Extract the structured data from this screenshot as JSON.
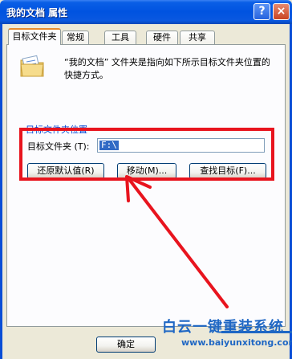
{
  "window": {
    "title": "我的文档 属性",
    "help_glyph": "?",
    "close_glyph": "×"
  },
  "tabs": [
    {
      "label": "目标文件夹",
      "active": true
    },
    {
      "label": "常规",
      "active": false
    },
    {
      "label": "工具",
      "active": false
    },
    {
      "label": "硬件",
      "active": false
    },
    {
      "label": "共享",
      "active": false
    }
  ],
  "content": {
    "description": "“我的文档” 文件夹是指向如下所示目标文件夹位置的快捷方式。",
    "group_title": "目标文件夹位置",
    "field_label": "目标文件夹 (T):",
    "field_value": "F:\\"
  },
  "buttons": {
    "restore_default": "还原默认值(R)",
    "move": "移动(M)...",
    "find_target": "查找目标(F)...",
    "ok": "确定"
  },
  "watermark": {
    "title": "白云一键重装系统",
    "url": "www.baiyunxitong.com"
  },
  "colors": {
    "highlight": "#e8141e",
    "titlebar": "#0053e0",
    "watermark": "#1f67c4"
  }
}
